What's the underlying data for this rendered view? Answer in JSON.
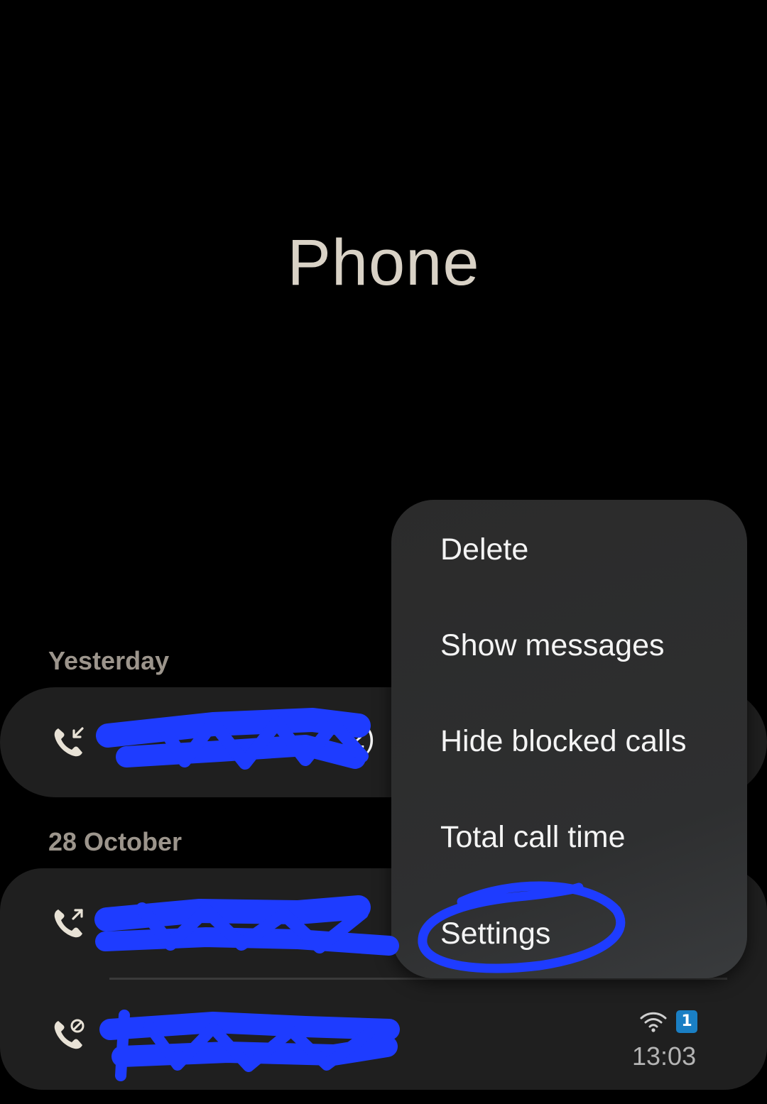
{
  "app": {
    "title": "Phone"
  },
  "call_log": {
    "sections": [
      {
        "header": "Yesterday",
        "entries": [
          {
            "call_type": "incoming-call-icon",
            "name_suffix": "2)"
          }
        ]
      },
      {
        "header": "28 October",
        "entries": [
          {
            "call_type": "outgoing-call-icon"
          },
          {
            "call_type": "blocked-call-icon",
            "time": "13:03",
            "sim": "1",
            "wifi_calling": "wifi-icon"
          }
        ]
      }
    ]
  },
  "overflow_menu": {
    "items": [
      "Delete",
      "Show messages",
      "Hide blocked calls",
      "Total call time",
      "Settings"
    ]
  },
  "colors": {
    "background": "#000000",
    "card": "#1f1f1f",
    "menu": "#2e2f30",
    "title": "#d9d2c6",
    "section_header": "#9c958c",
    "redaction_scribble": "#1e3cff",
    "sim_badge": "#1a7fc4"
  }
}
